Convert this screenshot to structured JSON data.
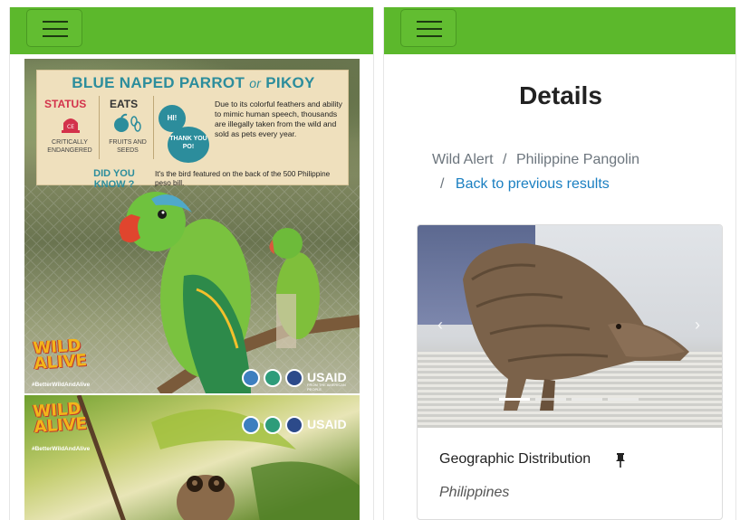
{
  "left": {
    "poster": {
      "title_main": "BLUE NAPED PARROT",
      "title_or": "or",
      "title_alt": "PIKOY",
      "status_label": "STATUS",
      "status_badge": "CE",
      "status_sub": "CRITICALLY ENDANGERED",
      "eats_label": "EATS",
      "eats_sub": "FRUITS AND SEEDS",
      "bubble_hi": "HI!",
      "bubble_thanks": "THANK YOU PO!",
      "description": "Due to its colorful feathers and ability to mimic human speech, thousands are illegally taken from the wild and sold as pets every year.",
      "dyk_label": "DID YOU KNOW ?",
      "dyk_fact": "It's the bird featured on the back of the 500 Philippine peso bill.",
      "logo_line1": "WILD",
      "logo_line2": "ALIVE",
      "hashtag": "#BetterWildAndAlive",
      "usaid": "USAID",
      "usaid_sub": "FROM THE AMERICAN PEOPLE"
    },
    "poster2": {
      "logo_line1": "WILD",
      "logo_line2": "ALIVE",
      "hashtag": "#BetterWildAndAlive",
      "usaid": "USAID"
    }
  },
  "right": {
    "page_title": "Details",
    "breadcrumb": {
      "root": "Wild Alert",
      "separator": "/",
      "current": "Philippine Pangolin",
      "back_link": "Back to previous results"
    },
    "carousel": {
      "prev_icon": "chevron-left-icon",
      "next_icon": "chevron-right-icon",
      "slide_count": 4,
      "active_slide": 1
    },
    "card": {
      "section_title": "Geographic Distribution",
      "section_icon": "pin-icon",
      "section_value": "Philippines"
    }
  },
  "colors": {
    "topbar": "#5cb82c",
    "link": "#1a7fc1",
    "poster_teal": "#2c8d9c",
    "status_red": "#d3324b"
  }
}
